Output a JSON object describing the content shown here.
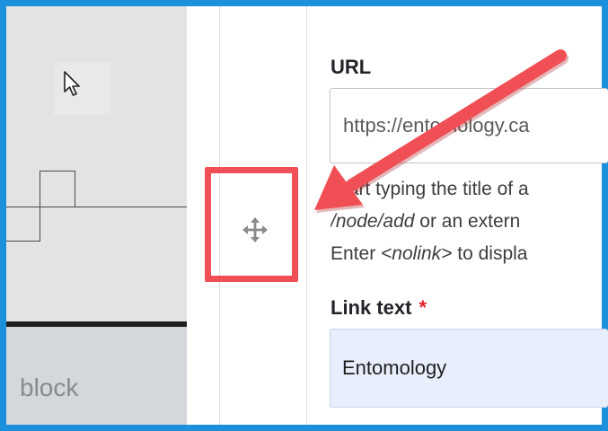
{
  "left_panel": {
    "block_label": "block"
  },
  "url_field": {
    "label": "URL",
    "value": "https://entomology.ca"
  },
  "description": {
    "line1": "Start typing the title of a",
    "line2_path": "/node/add",
    "line2_rest": " or an extern",
    "line3_prefix": "Enter ",
    "line3_tag": "<nolink>",
    "line3_rest": " to displa"
  },
  "link_text_field": {
    "label": "Link text",
    "required_marker": "*",
    "value": "Entomology"
  },
  "icons": {
    "cursor": "mouse-pointer-icon",
    "drag": "move-arrows-icon",
    "annotation": "red-arrow-annotation"
  },
  "colors": {
    "frame_border": "#1c8fdd",
    "annotation_red": "#ef4f55",
    "required_red": "#e2212c",
    "link_input_bg": "#e8eefb"
  }
}
